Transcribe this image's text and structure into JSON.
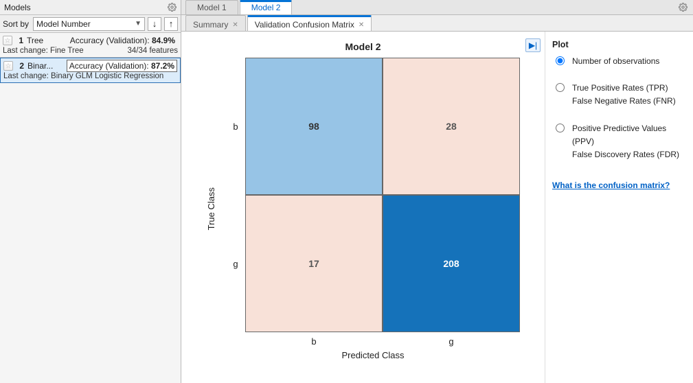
{
  "left": {
    "title": "Models",
    "sort_label": "Sort by",
    "sort_value": "Model Number"
  },
  "models": [
    {
      "num": "1",
      "name": "Tree",
      "acc_label": "Accuracy (Validation):",
      "acc_value": "84.9%",
      "change_label": "Last change: Fine Tree",
      "features": "34/34 features",
      "selected": false
    },
    {
      "num": "2",
      "name": "Binar...",
      "acc_label": "Accuracy (Validation):",
      "acc_value": "87.2%",
      "change_label": "Last change: Binary GLM Logistic Regression",
      "features": "",
      "selected": true
    }
  ],
  "tabs": {
    "model1": "Model 1",
    "model2": "Model 2",
    "summary": "Summary",
    "confmat": "Validation Confusion Matrix"
  },
  "chart_data": {
    "type": "heatmap",
    "title": "Model 2",
    "xlabel": "Predicted Class",
    "ylabel": "True Class",
    "row_labels": [
      "b",
      "g"
    ],
    "col_labels": [
      "b",
      "g"
    ],
    "values": [
      [
        98,
        28
      ],
      [
        17,
        208
      ]
    ],
    "cell_colors": [
      [
        "#97c4e6",
        "#f8e1d8"
      ],
      [
        "#f8e1d8",
        "#1572ba"
      ]
    ]
  },
  "controls": {
    "heading": "Plot",
    "opt1": "Number of observations",
    "opt2a": "True Positive Rates (TPR)",
    "opt2b": "False Negative Rates (FNR)",
    "opt3a": "Positive Predictive Values (PPV)",
    "opt3b": "False Discovery Rates (FDR)",
    "help": "What is the confusion matrix?"
  }
}
